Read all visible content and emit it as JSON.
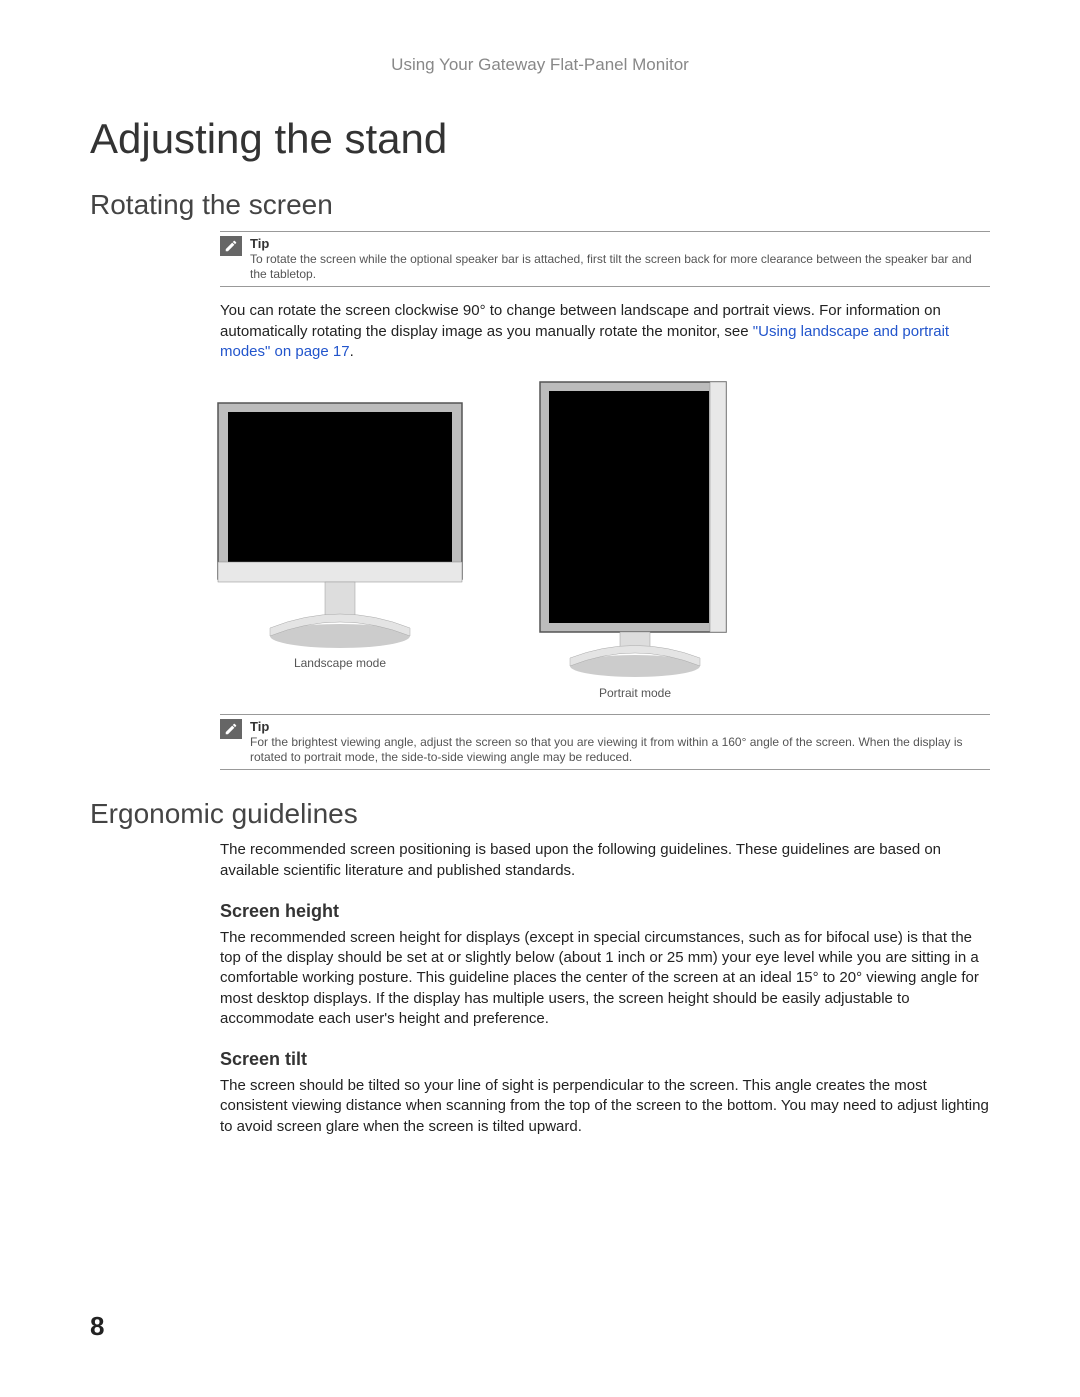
{
  "header": "Using Your Gateway Flat-Panel Monitor",
  "title": "Adjusting the stand",
  "section1": {
    "heading": "Rotating the screen",
    "tip1": {
      "label": "Tip",
      "text": "To rotate the screen while the optional speaker bar is attached, first tilt the screen back for more clearance between the speaker bar and the tabletop."
    },
    "body_part1": "You can rotate the screen clockwise 90° to change between landscape and portrait views. For information on automatically rotating the display image as you manually rotate the monitor, see ",
    "link": "\"Using landscape and portrait modes\" on page 17",
    "body_part2": ".",
    "caption_landscape": "Landscape mode",
    "caption_portrait": "Portrait mode",
    "tip2": {
      "label": "Tip",
      "text": "For the brightest viewing angle, adjust the screen so that you are viewing it from within a 160° angle of the screen. When the display is rotated to portrait mode, the side-to-side viewing angle may be reduced."
    }
  },
  "section2": {
    "heading": "Ergonomic guidelines",
    "intro": "The recommended screen positioning is based upon the following guidelines. These guidelines are based on available scientific literature and published standards.",
    "screen_height": {
      "heading": "Screen height",
      "body": "The recommended screen height for displays (except in special circumstances, such as for bifocal use) is that the top of the display should be set at or slightly below (about 1 inch or 25 mm) your eye level while you are sitting in a comfortable working posture. This guideline places the center of the screen at an ideal 15° to 20° viewing angle for most desktop displays. If the display has multiple users, the screen height should be easily adjustable to accommodate each user's height and preference."
    },
    "screen_tilt": {
      "heading": "Screen tilt",
      "body": "The screen should be tilted so your line of sight is perpendicular to the screen. This angle creates the most consistent viewing distance when scanning from the top of the screen to the bottom. You may need to adjust lighting to avoid screen glare when the screen is tilted upward."
    }
  },
  "page_number": "8"
}
